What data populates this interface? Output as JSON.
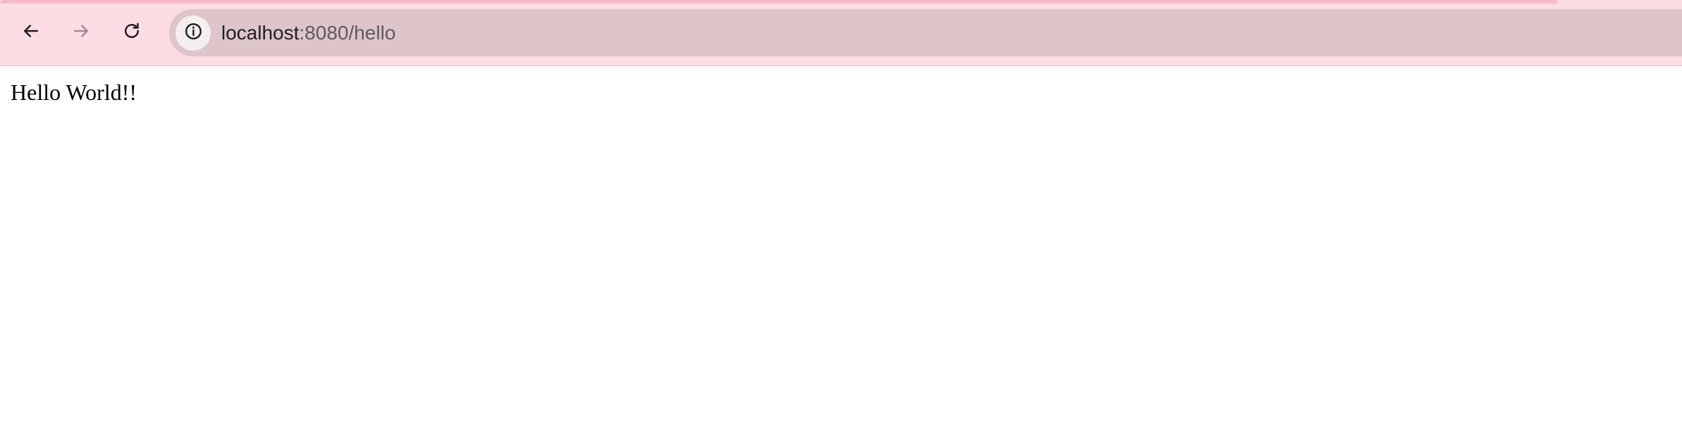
{
  "browser": {
    "toolbar": {
      "back_icon": "arrow-left-icon",
      "forward_icon": "arrow-right-icon",
      "reload_icon": "reload-icon",
      "site_info_icon": "info-icon",
      "forward_disabled": true
    },
    "address_bar": {
      "host": "localhost",
      "rest": ":8080/hello"
    },
    "colors": {
      "toolbar_bg": "#fcdde3",
      "address_bar_bg": "#dec5c9",
      "accent": "#f7b9c7"
    }
  },
  "page": {
    "text": "Hello World!!"
  }
}
